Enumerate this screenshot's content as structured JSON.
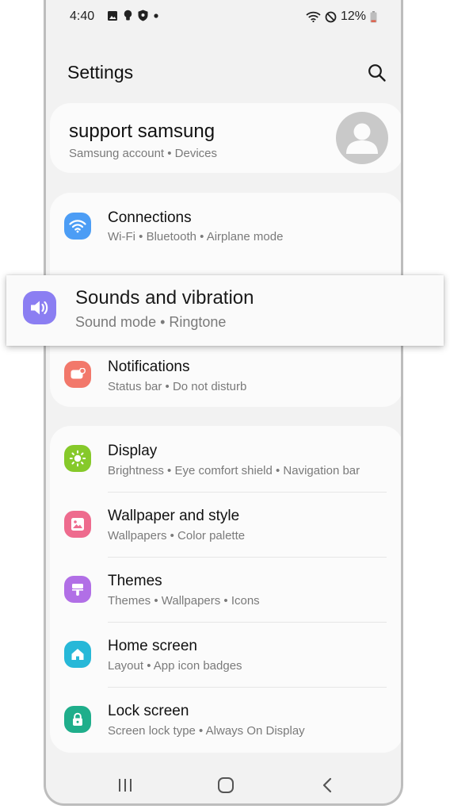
{
  "status_bar": {
    "time": "4:40",
    "left_icons": [
      "gallery-icon",
      "bulb-icon",
      "shield-icon",
      "dot-icon"
    ],
    "right_icons": [
      "wifi-icon",
      "do-not-disturb-icon",
      "battery-icon"
    ],
    "battery": "12%"
  },
  "header": {
    "title": "Settings"
  },
  "account": {
    "name": "support samsung",
    "sub": "Samsung account  •  Devices"
  },
  "group1": [
    {
      "label": "Connections",
      "sub": "Wi-Fi  •  Bluetooth  •  Airplane mode",
      "icon": "wifi-icon",
      "color": "#4c9df5"
    }
  ],
  "highlight": {
    "label": "Sounds and vibration",
    "sub": "Sound mode  •  Ringtone",
    "icon": "volume-icon",
    "color": "#8b7ef2"
  },
  "group1b": [
    {
      "label": "Notifications",
      "sub": "Status bar  •  Do not disturb",
      "icon": "notification-icon",
      "color": "#f2786b"
    }
  ],
  "group2": [
    {
      "label": "Display",
      "sub": "Brightness  •  Eye comfort shield  •  Navigation bar",
      "icon": "sun-icon",
      "color": "#86c92a"
    },
    {
      "label": "Wallpaper and style",
      "sub": "Wallpapers  •  Color palette",
      "icon": "wallpaper-icon",
      "color": "#ee6b8e"
    },
    {
      "label": "Themes",
      "sub": "Themes  •  Wallpapers  •  Icons",
      "icon": "themes-icon",
      "color": "#b16fe6"
    },
    {
      "label": "Home screen",
      "sub": "Layout  •  App icon badges",
      "icon": "home-icon",
      "color": "#27b8d8"
    },
    {
      "label": "Lock screen",
      "sub": "Screen lock type  •  Always On Display",
      "icon": "lock-icon",
      "color": "#1fae8b"
    }
  ]
}
